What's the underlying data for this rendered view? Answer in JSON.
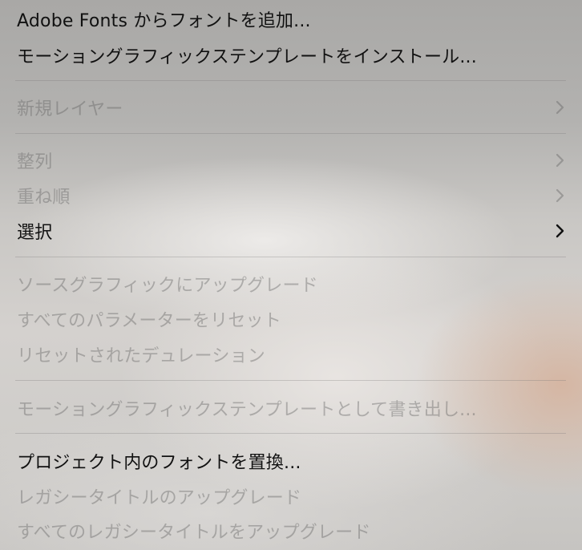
{
  "menu": {
    "items": [
      {
        "label": "Adobe Fonts からフォントを追加..."
      },
      {
        "label": "モーショングラフィックステンプレートをインストール..."
      },
      {
        "label": "新規レイヤー"
      },
      {
        "label": "整列"
      },
      {
        "label": "重ね順"
      },
      {
        "label": "選択"
      },
      {
        "label": "ソースグラフィックにアップグレード"
      },
      {
        "label": "すべてのパラメーターをリセット"
      },
      {
        "label": "リセットされたデュレーション"
      },
      {
        "label": "モーショングラフィックステンプレートとして書き出し..."
      },
      {
        "label": "プロジェクト内のフォントを置換..."
      },
      {
        "label": "レガシータイトルのアップグレード"
      },
      {
        "label": "すべてのレガシータイトルをアップグレード"
      }
    ],
    "icons": {
      "submenu": "chevron-right-icon"
    }
  }
}
